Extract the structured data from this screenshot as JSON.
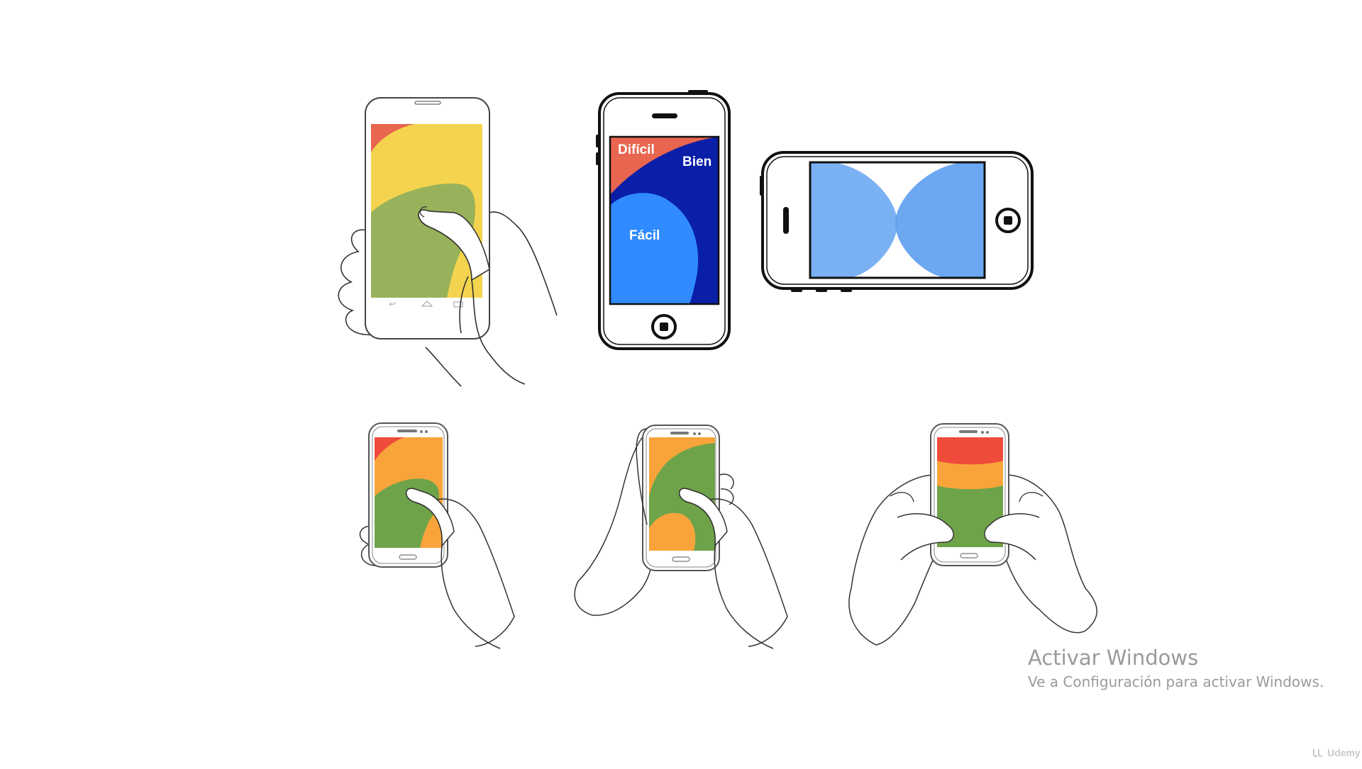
{
  "diagram": {
    "labels": {
      "hard": "Difícil",
      "good": "Bien",
      "easy": "Fácil"
    },
    "zone_colors": {
      "hard": "#e8654f",
      "good": "#0a1fa8",
      "easy": "#2f8bff",
      "red": "#ee4b3b",
      "yellow": "#f4d44e",
      "orange": "#f9a43a",
      "green": "#97b25a",
      "dark_green": "#6ea34a",
      "landscape_blue": "#6aa9f2"
    }
  },
  "watermark": {
    "title": "Activar Windows",
    "subtitle": "Ve a Configuración para activar Windows.",
    "brand": "Udemy"
  }
}
